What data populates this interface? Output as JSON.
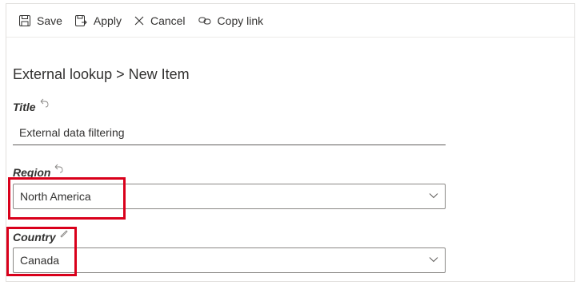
{
  "toolbar": {
    "save_label": "Save",
    "apply_label": "Apply",
    "cancel_label": "Cancel",
    "copy_link_label": "Copy link"
  },
  "breadcrumb": "External lookup > New Item",
  "fields": {
    "title": {
      "label": "Title",
      "value": "External data filtering"
    },
    "region": {
      "label": "Region",
      "value": "North America"
    },
    "country": {
      "label": "Country",
      "value": "Canada"
    }
  },
  "colors": {
    "highlight": "#d9001b",
    "text": "#323130",
    "border": "#8a8886"
  },
  "icons": [
    "save-icon",
    "apply-icon",
    "cancel-icon",
    "copy-link-icon",
    "undo-icon",
    "edit-icon",
    "chevron-down-icon"
  ]
}
